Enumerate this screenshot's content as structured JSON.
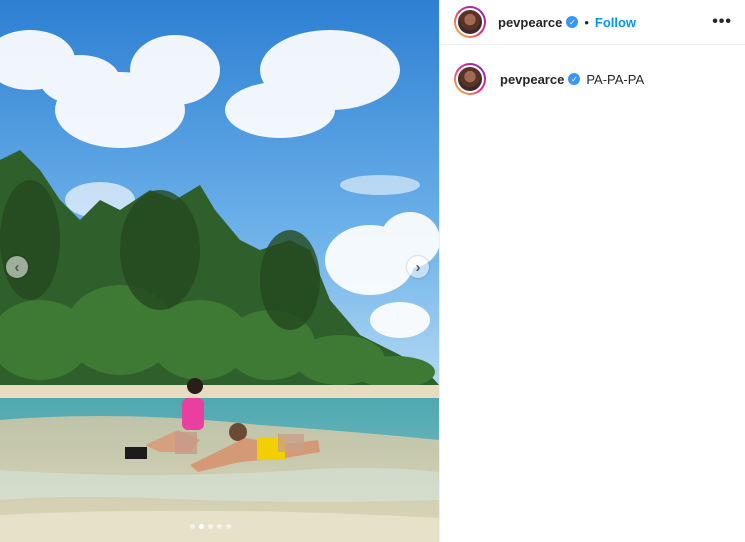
{
  "post": {
    "username": "pevpearce",
    "follow_label": "Follow",
    "separator": "•",
    "more_label": "•••",
    "caption": "PA-PA-PA",
    "verified_icon": "✓"
  },
  "carousel": {
    "prev_symbol": "‹",
    "next_symbol": "›",
    "slide_count": 5,
    "active_slide": 2
  },
  "colors": {
    "accent": "#0095f6",
    "verified": "#3897f0",
    "sky": "#3f8fd8",
    "sea": "#5ab0b4"
  }
}
